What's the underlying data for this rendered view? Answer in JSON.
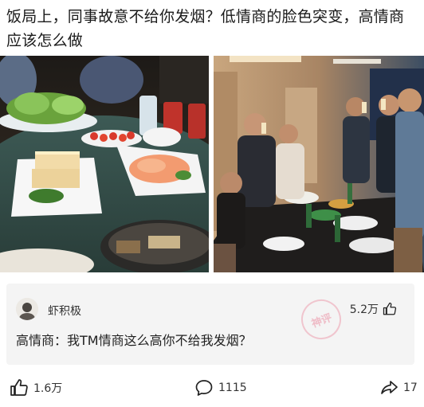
{
  "post": {
    "title": "饭局上，同事故意不给你发烟？低情商的脸色突变，高情商应该怎么做"
  },
  "comment": {
    "username": "虾积极",
    "likes": "5.2万",
    "text": "高情商：我TM情商这么高你不给我发烟？",
    "watermark": "神评"
  },
  "actions": {
    "like_count": "1.6万",
    "comment_count": "1115",
    "share_count": "17"
  },
  "icons": {
    "like": "thumbs-up-icon",
    "comment": "speech-bubble-icon",
    "share": "share-arrow-icon"
  },
  "colors": {
    "text": "#1a1a1a",
    "card_bg": "#f4f4f4",
    "watermark": "#e76e87"
  }
}
